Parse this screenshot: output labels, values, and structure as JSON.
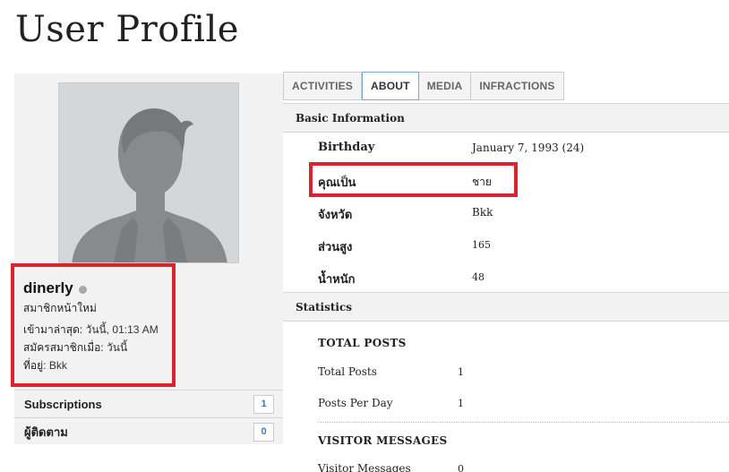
{
  "page": {
    "title": "User Profile"
  },
  "sidebar": {
    "username": "dinerly",
    "usertitle": "สมาชิกหน้าใหม่",
    "last_activity_label": "เข้ามาล่าสุด:",
    "last_activity_value": "วันนี้, 01:13 AM",
    "join_date_label": "สมัครสมาชิกเมื่อ:",
    "join_date_value": "วันนี้",
    "location_label": "ที่อยู่:",
    "location_value": "Bkk",
    "subscriptions_label": "Subscriptions",
    "subscriptions_count": "1",
    "followers_label": "ผู้ติดตาม",
    "followers_count": "0"
  },
  "tabs": [
    {
      "label": "ACTIVITIES",
      "active": false
    },
    {
      "label": "ABOUT",
      "active": true
    },
    {
      "label": "MEDIA",
      "active": false
    },
    {
      "label": "INFRACTIONS",
      "active": false
    }
  ],
  "basic_info": {
    "heading": "Basic Information",
    "fields": [
      {
        "label": "Birthday",
        "value": "January 7, 1993 (24)"
      },
      {
        "label": "คุณเป็น",
        "value": "ชาย"
      },
      {
        "label": "จังหวัด",
        "value": "Bkk"
      },
      {
        "label": "ส่วนสูง",
        "value": "165"
      },
      {
        "label": "น้ำหนัก",
        "value": "48"
      }
    ]
  },
  "statistics": {
    "heading": "Statistics",
    "total_posts_title": "TOTAL POSTS",
    "total_posts_label": "Total Posts",
    "total_posts_value": "1",
    "posts_per_day_label": "Posts Per Day",
    "posts_per_day_value": "1",
    "visitor_messages_title": "VISITOR MESSAGES",
    "visitor_messages_label": "Visitor Messages",
    "visitor_messages_value": "0"
  },
  "colors": {
    "highlight": "#d9242f",
    "active_tab_border": "#7aa5cc",
    "badge_text": "#3d7ab5"
  }
}
